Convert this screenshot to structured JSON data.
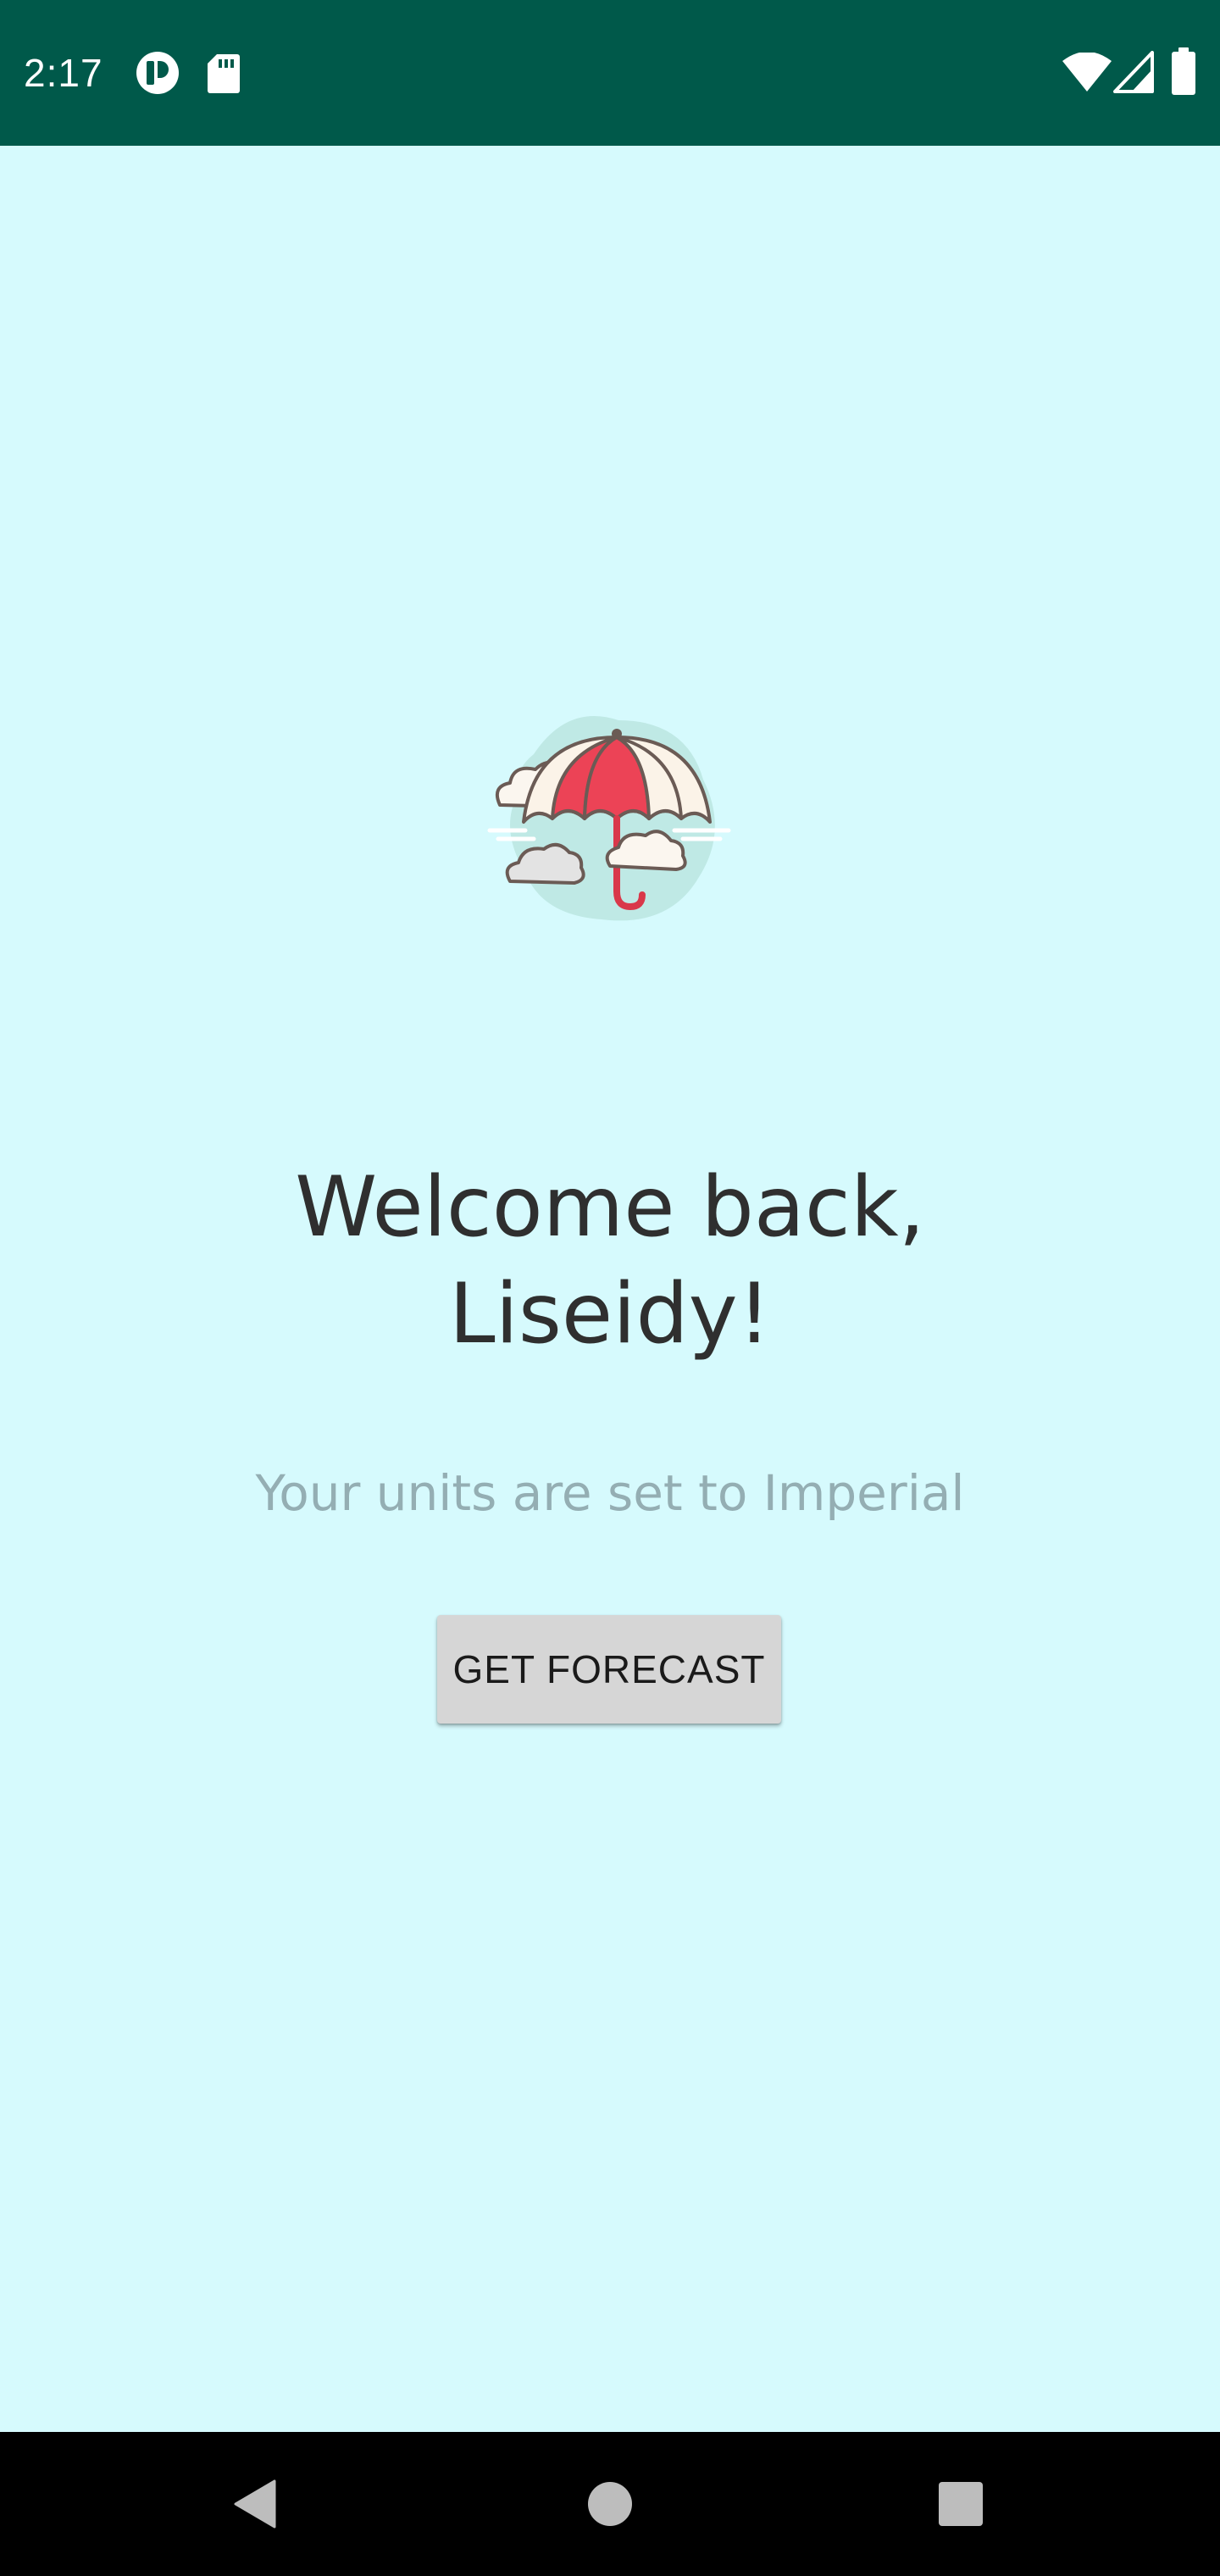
{
  "status_bar": {
    "time": "2:17",
    "background_color": "#00594A",
    "left_icons": [
      "notification-app-icon",
      "sd-card-icon"
    ],
    "right_icons": [
      "wifi-icon",
      "cellular-signal-icon",
      "battery-icon"
    ]
  },
  "screen": {
    "background_color": "#D6FAFD",
    "illustration_icon": "umbrella-clouds-icon",
    "welcome_line1": "Welcome back,",
    "welcome_line2": "Liseidy!",
    "units_text": "Your units are set to Imperial",
    "forecast_button_label": "GET FORECAST"
  },
  "nav_bar": {
    "buttons": [
      "back-icon",
      "home-icon",
      "recents-icon"
    ]
  }
}
